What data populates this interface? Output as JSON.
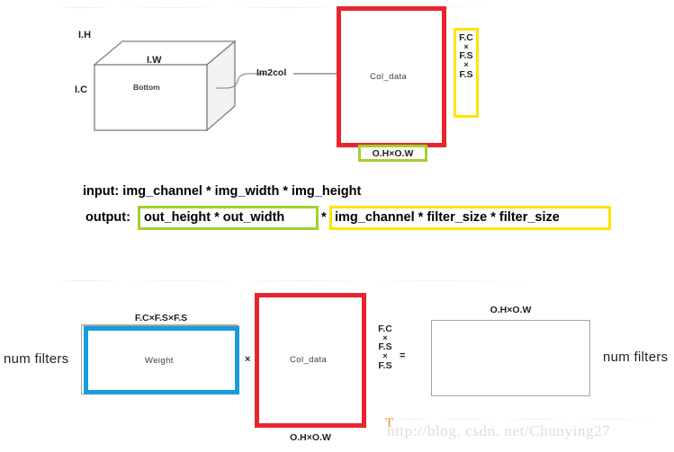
{
  "diagram": {
    "title_hidden": "im2col convolution as matrix multiplication",
    "top": {
      "cube": {
        "label_height": "I.H",
        "label_width": "I.W",
        "label_channel": "I.C",
        "face_label": "Bottom"
      },
      "arrow_label": "Im2col",
      "col_data_box": {
        "label": "Col_data",
        "bottom_caption": "O.H×O.W",
        "right_dims": [
          "F.C",
          "×",
          "F.S",
          "×",
          "F.S"
        ]
      }
    },
    "formulas": {
      "input_line": "input: img_channel * img_width * img_height",
      "output_prefix": "output:",
      "output_green": "out_height * out_width",
      "output_operator": "*",
      "output_yellow": "img_channel * filter_size * filter_size"
    },
    "bottom": {
      "weight_box": {
        "label": "Weight",
        "top_caption": "F.C×F.S×F.S",
        "left_caption": "num  filters"
      },
      "multiply_operator": "×",
      "col_data_box": {
        "label": "Col_data",
        "bottom_caption": "O.H×O.W",
        "left_dims": [
          "F.C",
          "×",
          "F.S",
          "×",
          "F.S"
        ]
      },
      "equals_operator": "=",
      "result_box": {
        "top_caption": "O.H×O.W",
        "right_caption": "num  filters"
      }
    },
    "watermark": {
      "caret": "T",
      "text": "http://blog. csdn. net/Chunying27"
    },
    "colors": {
      "red": "#e8252c",
      "blue": "#1a9be0",
      "yellow": "#ffe400",
      "green": "#a2d22a",
      "gray_line": "#7f7f7f",
      "text": "#231f20",
      "watermark": "#e8d9d6",
      "caret": "#f08a28"
    }
  }
}
